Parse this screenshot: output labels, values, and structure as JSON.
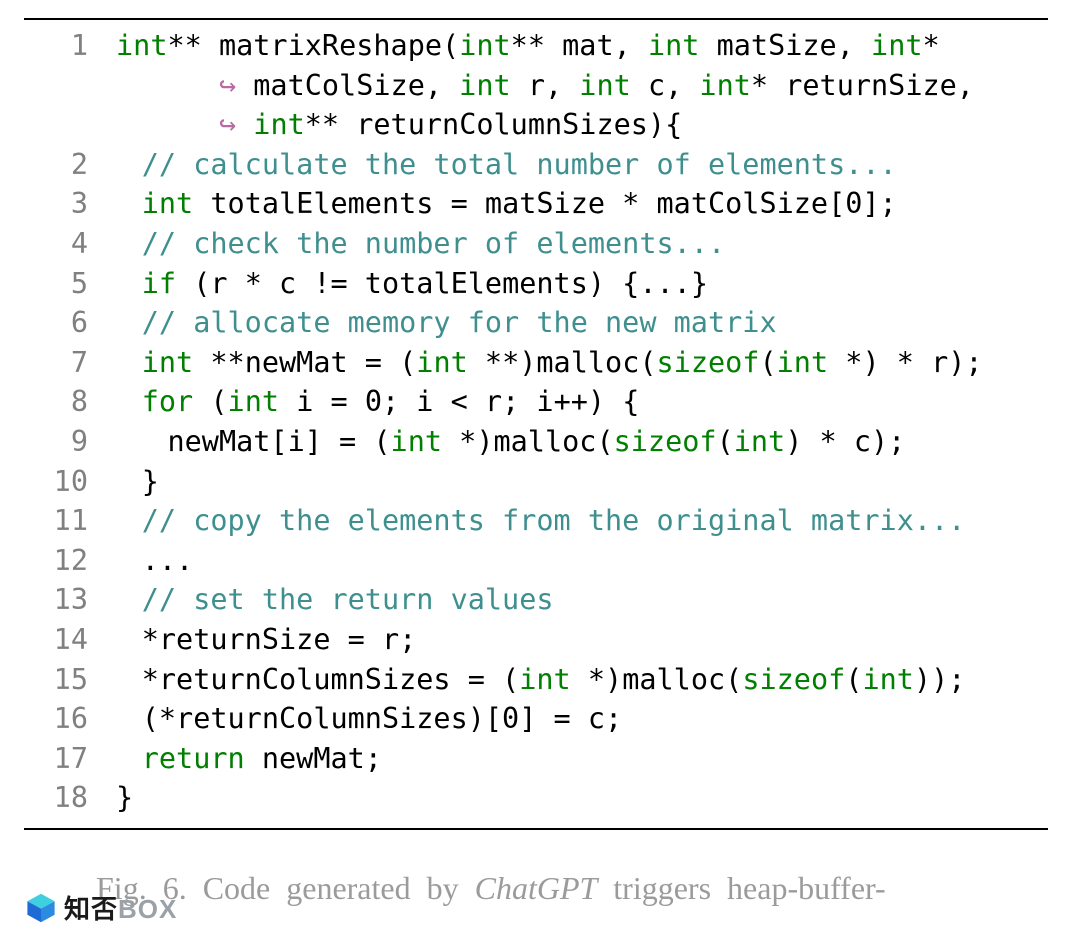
{
  "code": {
    "lines": [
      {
        "n": "1",
        "cls": "",
        "html": "<span class='kw'>int</span>** matrixReshape(<span class='kw'>int</span>** mat, <span class='kw'>int</span> matSize, <span class='kw'>int</span>*"
      },
      {
        "n": "",
        "cls": "indent3",
        "html": "<span class='arr'>↪</span> matColSize, <span class='kw'>int</span> r, <span class='kw'>int</span> c, <span class='kw'>int</span>* returnSize,"
      },
      {
        "n": "",
        "cls": "indent3",
        "html": "<span class='arr'>↪</span> <span class='kw'>int</span>** returnColumnSizes){"
      },
      {
        "n": "2",
        "cls": "indent1",
        "html": "<span class='cm'>// calculate the total number of elements...</span>"
      },
      {
        "n": "3",
        "cls": "indent1",
        "html": "<span class='kw'>int</span> totalElements = matSize * matColSize[0];"
      },
      {
        "n": "4",
        "cls": "indent1",
        "html": "<span class='cm'>// check the number of elements...</span>"
      },
      {
        "n": "5",
        "cls": "indent1",
        "html": "<span class='kw'>if</span> (r * c != totalElements) {...}"
      },
      {
        "n": "6",
        "cls": "indent1",
        "html": "<span class='cm'>// allocate memory for the new matrix</span>"
      },
      {
        "n": "7",
        "cls": "indent1",
        "html": "<span class='kw'>int</span> **newMat = (<span class='kw'>int</span> **)malloc(<span class='kw'>sizeof</span>(<span class='kw'>int</span> *) * r);"
      },
      {
        "n": "8",
        "cls": "indent1",
        "html": "<span class='kw'>for</span> (<span class='kw'>int</span> i = 0; i < r; i++) {"
      },
      {
        "n": "9",
        "cls": "indent2",
        "html": "newMat[i] = (<span class='kw'>int</span> *)malloc(<span class='kw'>sizeof</span>(<span class='kw'>int</span>) * c);"
      },
      {
        "n": "10",
        "cls": "indent1",
        "html": "}"
      },
      {
        "n": "11",
        "cls": "indent1",
        "html": "<span class='cm'>// copy the elements from the original matrix...</span>"
      },
      {
        "n": "12",
        "cls": "indent1",
        "html": "..."
      },
      {
        "n": "13",
        "cls": "indent1",
        "html": "<span class='cm'>// set the return values</span>"
      },
      {
        "n": "14",
        "cls": "indent1",
        "html": "*returnSize = r;"
      },
      {
        "n": "15",
        "cls": "indent1",
        "html": "*returnColumnSizes = (<span class='kw'>int</span> *)malloc(<span class='kw'>sizeof</span>(<span class='kw'>int</span>));"
      },
      {
        "n": "16",
        "cls": "indent1",
        "html": "(*returnColumnSizes)[0] = c;"
      },
      {
        "n": "17",
        "cls": "indent1",
        "html": "<span class='kw'>return</span> newMat;"
      },
      {
        "n": "18",
        "cls": "",
        "html": "}"
      }
    ]
  },
  "caption": {
    "label": "Fig. 6.",
    "text_before": "Code generated by ",
    "italic": "ChatGPT",
    "text_after": " triggers heap-buffer-"
  },
  "watermark": {
    "text_cn": "知否",
    "text_en": "BOX"
  }
}
